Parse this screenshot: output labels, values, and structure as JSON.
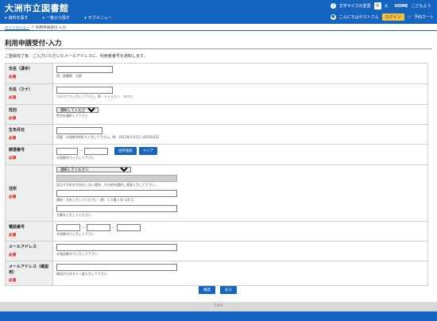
{
  "header": {
    "site_title": "大洲市立図書館",
    "nav": [
      "資料を探す",
      "一覧から探す",
      "サブメニュー"
    ],
    "fontsize_label": "文字サイズの変更",
    "fontsize_normal": "中",
    "fontsize_large": "大",
    "home": "HOME",
    "kids": "こどもよう",
    "greeting": "こんにちはゲストさん",
    "login": "ログイン",
    "cart": "予約カート"
  },
  "breadcrumb": {
    "top": "メインメニュー",
    "sep": ">",
    "current": "利用申請受付-入力"
  },
  "page": {
    "title": "利用申請受付-入力",
    "intro": "ご登録完了後、ご入力いただいたメールアドレスに、利用者番号を通知します。"
  },
  "required_label": "必須",
  "form": {
    "name_kanji": {
      "label": "氏名（漢字）",
      "hint": "例：図書館　太郎"
    },
    "name_kana": {
      "label": "氏名（カナ）",
      "hint": "カタカナで入力して下さい。例：トショカン　タロウ"
    },
    "gender": {
      "label": "性別",
      "selected": "選択してください",
      "hint": "性別を選択して下さい"
    },
    "birthday": {
      "label": "生年月日",
      "hint": "西暦・半角数字8桁で入力して下さい。例：2013年2月1日→20130201"
    },
    "postal": {
      "label": "郵便番号",
      "search_btn": "住所検索",
      "clear_btn": "クリア",
      "hint": "半角数字で入力して下さい"
    },
    "address": {
      "label": "住所",
      "selected": "選択してください",
      "hint1": "該当する町名が存在しない場合、その他を選択し直接入力して下さい。",
      "hint2": "番地・号を入力してください（例：１０番１号→10-1）",
      "hint3": "方書を入力してください"
    },
    "phone": {
      "label": "電話番号",
      "hint": "半角数字で入力して下さい"
    },
    "email": {
      "label": "メールアドレス",
      "hint": "半角英数字で入力して下さい"
    },
    "email_confirm": {
      "label": "メールアドレス（確認用）",
      "hint": "確認のためもう一度入力して下さい"
    }
  },
  "actions": {
    "confirm": "確認",
    "back": "戻る"
  },
  "footer": {
    "top": "TOP"
  }
}
